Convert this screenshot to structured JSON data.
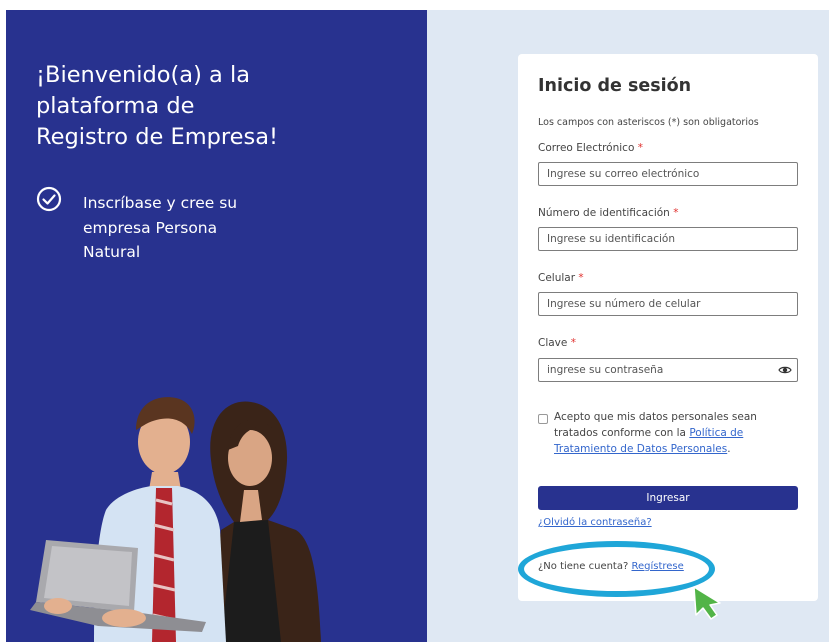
{
  "welcome": {
    "title_lines": [
      "¡Bienvenido(a) a la",
      "plataforma de",
      "Registro de Empresa!"
    ],
    "feature_lines": [
      "Inscríbase y cree su",
      "empresa Persona",
      "Natural"
    ],
    "feature_icon": "check-circle-icon"
  },
  "login": {
    "title": "Inicio de sesión",
    "required_note": "Los campos con asteriscos (*) son obligatorios",
    "required_mark": "*",
    "email": {
      "label": "Correo Electrónico",
      "placeholder": "Ingrese su correo electrónico"
    },
    "id_number": {
      "label": "Número de identificación",
      "placeholder": "Ingrese su identificación"
    },
    "phone": {
      "label": "Celular",
      "placeholder": "Ingrese su número de celular"
    },
    "password": {
      "label": "Clave",
      "placeholder": "ingrese su contraseña",
      "icon": "eye-icon"
    },
    "consent": {
      "text": "Acepto que mis datos personales sean tratados conforme con la",
      "link": "Política de Tratamiento de Datos Personales",
      "end": "."
    },
    "submit_label": "Ingresar",
    "forgot_label": "¿Olvidó la contraseña?",
    "no_account_text": "¿No tiene cuenta?",
    "register_label": "Regístrese"
  },
  "colors": {
    "brand_blue": "#28328f",
    "background": "#dfe8f3",
    "link": "#3366cc",
    "required": "#e0312f",
    "highlight": "#1fa6d8",
    "cursor": "#52b447"
  }
}
